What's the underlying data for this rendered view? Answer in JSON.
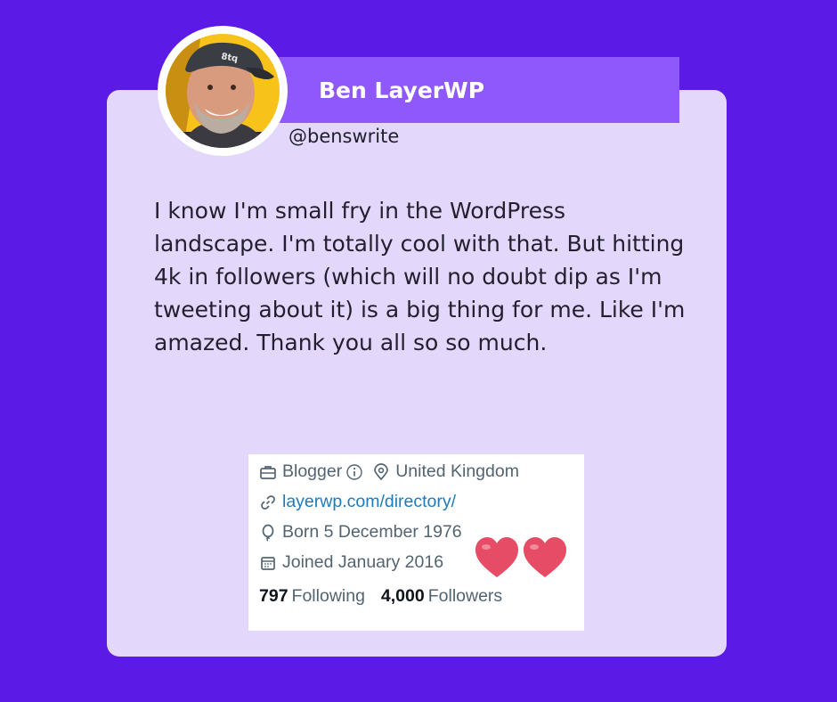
{
  "header": {
    "display_name": "Ben LayerWP",
    "handle": "@benswrite"
  },
  "tweet": {
    "text": "I know I'm small fry in the WordPress landscape. I'm totally cool with that. But hitting 4k in followers (which will no doubt dip as I'm tweeting about it) is a big thing for me. Like I'm amazed. Thank you all so so much."
  },
  "profile": {
    "category": "Blogger",
    "location": "United Kingdom",
    "website": "layerwp.com/directory/",
    "born": "Born 5 December 1976",
    "joined": "Joined January 2016",
    "following_count": "797",
    "following_label": "Following",
    "followers_count": "4,000",
    "followers_label": "Followers"
  },
  "icons": {
    "category": "briefcase-icon",
    "info": "info-icon",
    "location": "map-pin-icon",
    "website": "link-icon",
    "born": "balloon-icon",
    "joined": "calendar-icon",
    "decoration": "heart-icon"
  },
  "colors": {
    "background": "#5c1ae6",
    "card": "#e3d8fb",
    "banner": "#8f58fc",
    "link": "#1d7bbd",
    "heart": "#e64c66"
  }
}
